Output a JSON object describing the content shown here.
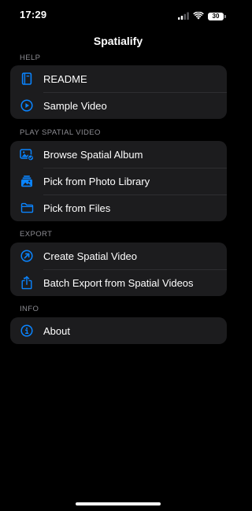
{
  "status_bar": {
    "time": "17:29",
    "battery": "30",
    "icons": [
      "signal-icon",
      "wifi-icon",
      "battery-icon"
    ]
  },
  "nav": {
    "title": "Spatialify"
  },
  "accent_color": "#0a84ff",
  "sections": {
    "help": {
      "header": "HELP",
      "items": [
        {
          "label": "README",
          "icon": "book-icon"
        },
        {
          "label": "Sample Video",
          "icon": "play-circle-icon"
        }
      ]
    },
    "play": {
      "header": "PLAY SPATIAL VIDEO",
      "items": [
        {
          "label": "Browse Spatial Album",
          "icon": "photo-album-icon"
        },
        {
          "label": "Pick from Photo Library",
          "icon": "photo-stack-icon"
        },
        {
          "label": "Pick from Files",
          "icon": "folder-icon"
        }
      ]
    },
    "export": {
      "header": "EXPORT",
      "items": [
        {
          "label": "Create Spatial Video",
          "icon": "create-arrow-circle-icon"
        },
        {
          "label": "Batch Export from Spatial Videos",
          "icon": "share-stack-icon"
        }
      ]
    },
    "info": {
      "header": "INFO",
      "items": [
        {
          "label": "About",
          "icon": "info-circle-icon"
        }
      ]
    }
  }
}
